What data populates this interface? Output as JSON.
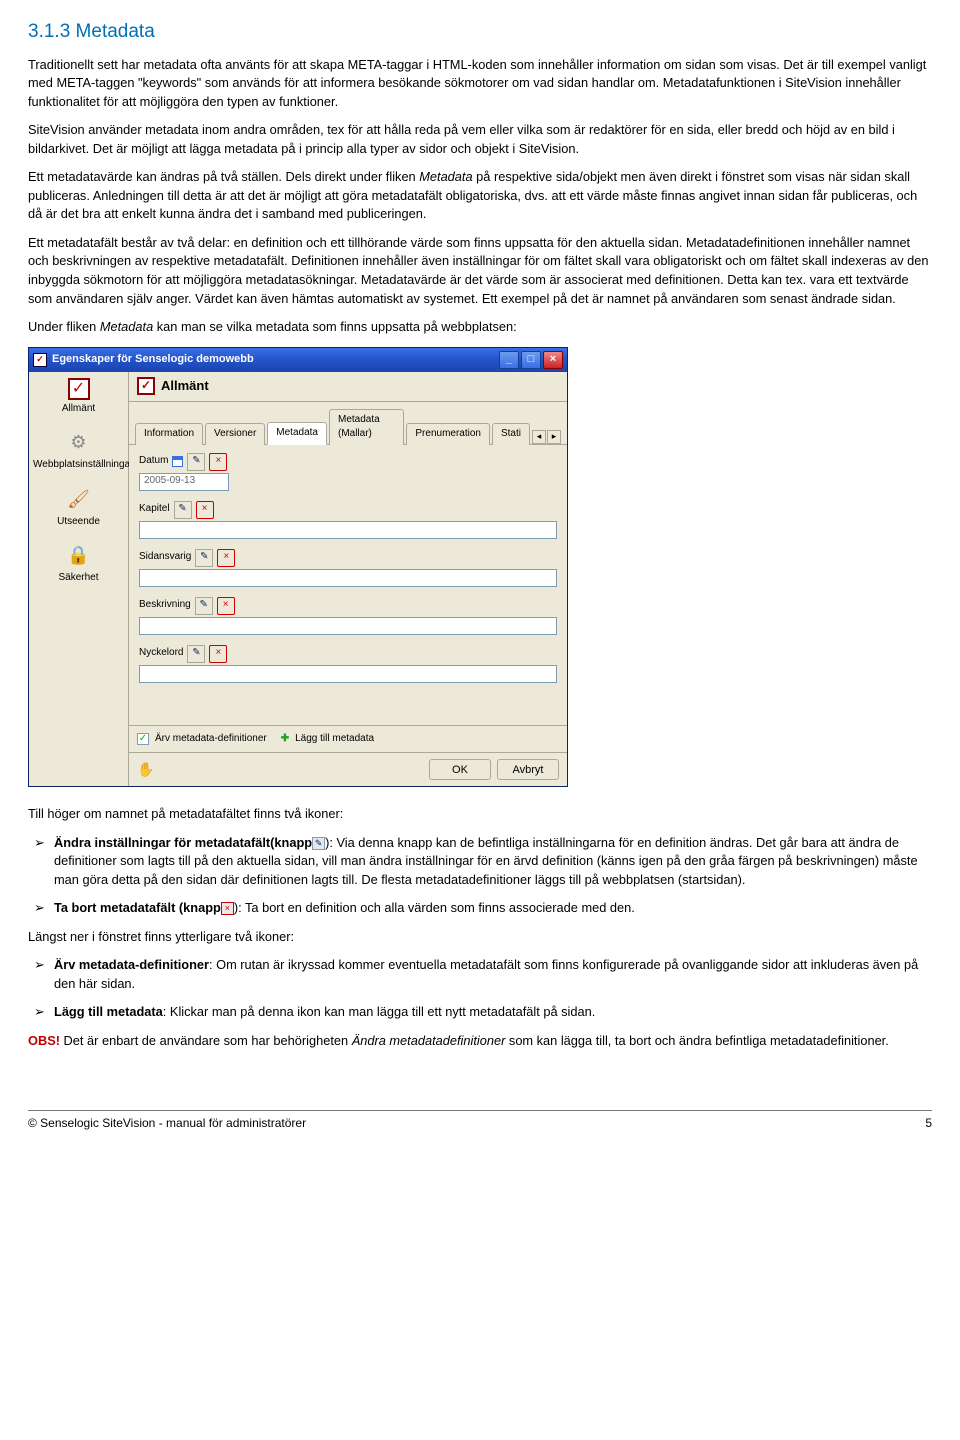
{
  "section": {
    "num": "3.1.3",
    "title": "Metadata"
  },
  "para1": "Traditionellt sett har metadata ofta använts för att skapa META-taggar i HTML-koden som innehåller information om sidan som visas. Det är till exempel vanligt med META-taggen \"keywords\" som används för att informera besökande sökmotorer om vad sidan handlar om. Metadatafunktionen i SiteVision innehåller funktionalitet för att möjliggöra den typen av funktioner.",
  "para2": "SiteVision använder metadata inom andra områden, tex för att hålla reda på vem eller vilka som är redaktörer för en sida, eller bredd och höjd av en bild i bildarkivet. Det är möjligt att lägga metadata på i princip alla typer av sidor och objekt i SiteVision.",
  "para3a": "Ett metadatavärde kan ändras på två ställen. Dels direkt under fliken ",
  "para3em": "Metadata",
  "para3b": " på respektive sida/objekt men även direkt i fönstret som visas när sidan skall publiceras. Anledningen till detta är att det är möjligt att göra metadatafält obligatoriska, dvs. att ett värde måste finnas angivet innan sidan får publiceras, och då är det bra att enkelt kunna ändra det i samband med publiceringen.",
  "para4": "Ett metadatafält består av två delar: en definition och ett  tillhörande värde som finns uppsatta för den aktuella sidan. Metadatadefinitionen innehåller namnet och beskrivningen av respektive metadatafält. Definitionen innehåller även inställningar för om fältet skall vara obligatoriskt och om fältet skall indexeras av den inbyggda sökmotorn för att möjliggöra metadatasökningar. Metadatavärde är det värde som är associerat med definitionen. Detta kan tex. vara ett textvärde som användaren själv anger. Värdet kan även hämtas automatiskt av systemet. Ett exempel på det är namnet på användaren som senast ändrade sidan.",
  "para5a": "Under fliken ",
  "para5em": "Metadata",
  "para5b": " kan man se vilka metadata som finns uppsatta på webbplatsen:",
  "dialog": {
    "title": "Egenskaper för Senselogic demowebb",
    "leftNav": [
      "Allmänt",
      "Webbplatsinställningar",
      "Utseende",
      "Säkerhet"
    ],
    "panelTitle": "Allmänt",
    "tabs": [
      "Information",
      "Versioner",
      "Metadata",
      "Metadata (Mallar)",
      "Prenumeration",
      "Stati"
    ],
    "activeTab": 2,
    "fields": [
      {
        "label": "Datum",
        "value": "2005-09-13",
        "short": true,
        "calendar": true
      },
      {
        "label": "Kapitel",
        "value": ""
      },
      {
        "label": "Sidansvarig",
        "value": ""
      },
      {
        "label": "Beskrivning",
        "value": ""
      },
      {
        "label": "Nyckelord",
        "value": ""
      }
    ],
    "inherit": "Ärv metadata-definitioner",
    "add": "Lägg till metadata",
    "ok": "OK",
    "cancel": "Avbryt"
  },
  "post1": "Till höger om namnet på metadatafältet finns två ikoner:",
  "bullet1a": "Ändra inställningar för metadatafält(knapp",
  "bullet1b": "): Via denna knapp kan de befintliga inställningarna för en definition ändras. Det går bara att ändra de definitioner som lagts till på den aktuella sidan, vill man ändra inställningar för en ärvd definition (känns igen på den gråa färgen på beskrivningen) måste man göra detta på den sidan där definitionen lagts till. De flesta metadatadefinitioner läggs till på webbplatsen (startsidan).",
  "bullet2a": "Ta bort metadatafält (knapp",
  "bullet2b": "): Ta bort en definition och alla värden som finns associerade med den.",
  "post2": "Längst ner i fönstret finns ytterligare två ikoner:",
  "bullet3a": "Ärv metadata-definitioner",
  "bullet3b": ": Om rutan är ikryssad kommer eventuella metadatafält som finns konfigurerade på ovanliggande sidor att inkluderas även på den här sidan.",
  "bullet4a": "Lägg till metadata",
  "bullet4b": ": Klickar man på denna ikon kan man lägga till ett nytt metadatafält på sidan.",
  "obs": "OBS!",
  "obsText1": " Det är enbart de användare som har behörigheten ",
  "obsEm": "Ändra metadatadefinitioner",
  "obsText2": " som kan lägga till, ta bort och ändra befintliga metadatadefinitioner.",
  "footer": {
    "left": "© Senselogic SiteVision - manual för administratörer",
    "right": "5"
  }
}
